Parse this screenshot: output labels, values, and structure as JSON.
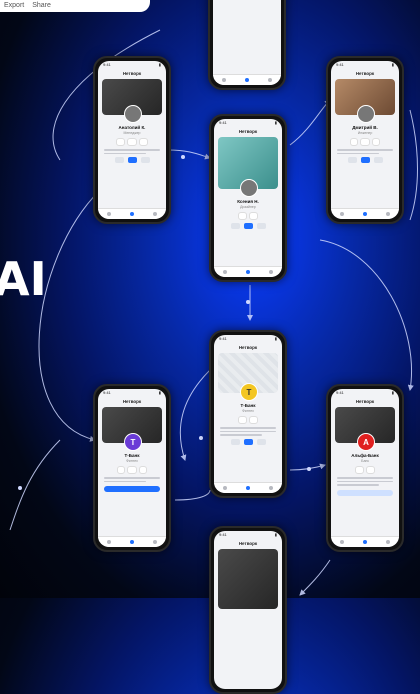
{
  "topbar": {
    "items": [
      "Export",
      "Share"
    ]
  },
  "brand": {
    "ai_text": "AI"
  },
  "app": {
    "title": "Нетворк",
    "time": "9:41"
  },
  "phones": [
    {
      "id": "top-center",
      "name": "",
      "role": "",
      "variant": "dark"
    },
    {
      "id": "left-upper",
      "name": "Анатолий К.",
      "role": "Менеджер",
      "variant": "dark"
    },
    {
      "id": "center-upper",
      "name": "Ксения Н.",
      "role": "Дизайнер",
      "variant": "teal"
    },
    {
      "id": "right-upper",
      "name": "Дмитрий В.",
      "role": "Инженер",
      "variant": "warm"
    },
    {
      "id": "center-middle",
      "name": "Т-Банк",
      "role": "Финтех",
      "variant": "light"
    },
    {
      "id": "left-lower",
      "name": "Т-Банк",
      "role": "Финтех",
      "variant": "dark"
    },
    {
      "id": "right-lower",
      "name": "Альфа-Банк",
      "role": "Банк",
      "variant": "dark"
    },
    {
      "id": "bottom-center",
      "name": "",
      "role": "",
      "variant": "dark"
    }
  ],
  "colors": {
    "accent": "#1f6fff",
    "bg_deep": "#020716",
    "bg_glow": "#0a3cff"
  }
}
